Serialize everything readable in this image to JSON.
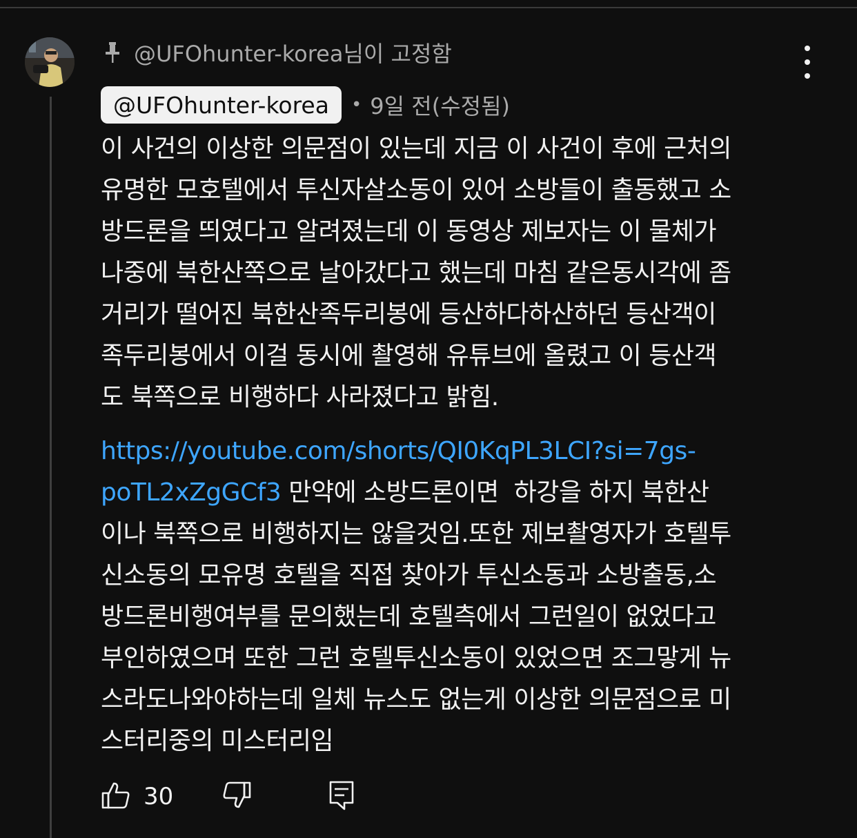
{
  "pinned": {
    "label": "@UFOhunter-korea님이 고정함"
  },
  "comment": {
    "author": "@UFOhunter-korea",
    "separator": "•",
    "time": "9일 전(수정됨)",
    "lines_part1": [
      "이 사건의 이상한 의문점이 있는데 지금 이 사건이 후에 근처의",
      "유명한 모호텔에서 투신자살소동이 있어 소방들이 출동했고 소",
      "방드론을 띄였다고 알려졌는데 이 동영상 제보자는 이 물체가",
      "나중에 북한산쪽으로 날아갔다고 했는데 마침 같은동시각에 좀",
      "거리가 떨어진 북한산족두리봉에 등산하다하산하던 등산객이",
      "족두리봉에서 이걸 동시에 촬영해 유튜브에 올렸고 이 등산객",
      "도 북쪽으로 비행하다 사라졌다고 밝힘."
    ],
    "link_line1": "https://youtube.com/shorts/QI0KqPL3LCI?si=7gs-",
    "link_line2": "poTL2xZgGCf3",
    "after_link": " 만약에 소방드론이면  하강을 하지 북한산",
    "lines_part2": [
      "이나 북쪽으로 비행하지는 않을것임.또한 제보촬영자가 호텔투",
      "신소동의 모유명 호텔을 직접 찾아가 투신소동과 소방출동,소",
      "방드론비행여부를 문의했는데 호텔측에서 그런일이 없었다고",
      "부인하였으며 또한 그런 호텔투신소동이 있었으면 조그맣게 뉴",
      "스라도나와야하는데 일체 뉴스도 없는게 이상한 의문점으로 미",
      "스터리중의 미스터리임"
    ],
    "like_count": "30"
  },
  "icons": {
    "pin": "pin-icon",
    "more": "more-vert-icon",
    "like": "thumb-up-icon",
    "dislike": "thumb-down-icon",
    "reply": "reply-icon"
  },
  "colors": {
    "background": "#0f0f0f",
    "text": "#f1f1f1",
    "secondary": "#aaaaaa",
    "link": "#3ea6ff",
    "chip": "#f1f1f1"
  }
}
